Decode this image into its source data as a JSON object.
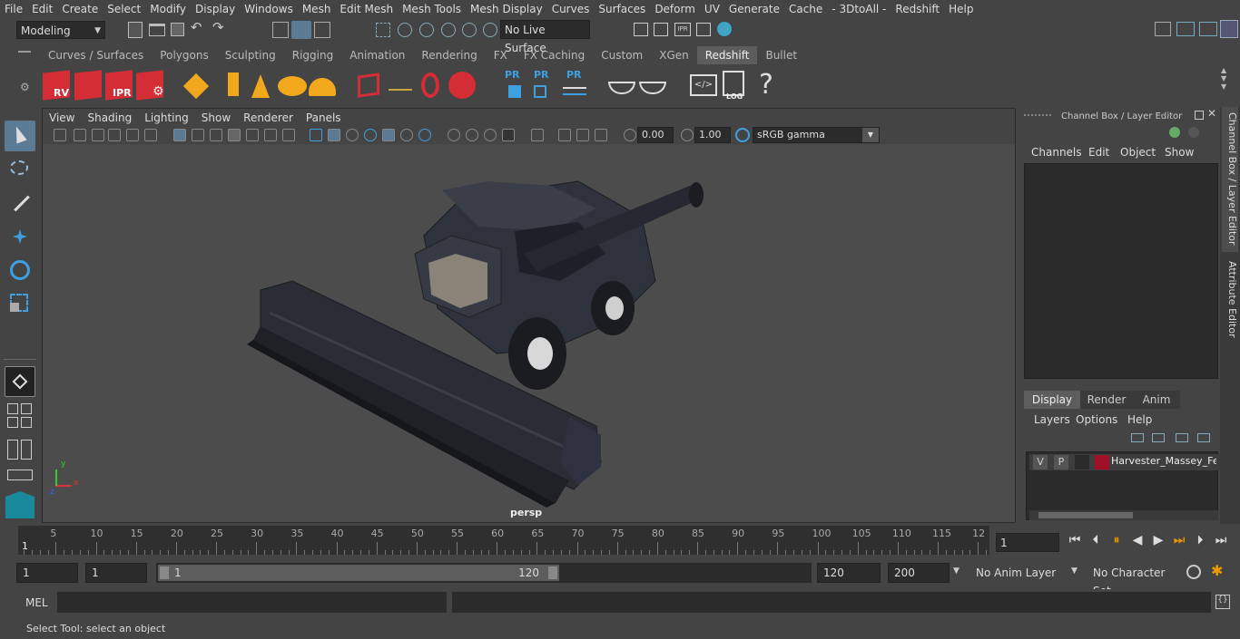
{
  "menubar": [
    "File",
    "Edit",
    "Create",
    "Select",
    "Modify",
    "Display",
    "Windows",
    "Mesh",
    "Edit Mesh",
    "Mesh Tools",
    "Mesh Display",
    "Curves",
    "Surfaces",
    "Deform",
    "UV",
    "Generate",
    "Cache",
    "- 3DtoAll -",
    "Redshift",
    "Help"
  ],
  "status": {
    "mode": "Modeling",
    "live_surface": "No Live Surface"
  },
  "shelf_tabs": [
    "Curves / Surfaces",
    "Polygons",
    "Sculpting",
    "Rigging",
    "Animation",
    "Rendering",
    "FX",
    "FX Caching",
    "Custom",
    "XGen",
    "Redshift",
    "Bullet"
  ],
  "shelf_active": "Redshift",
  "shelf_labels": {
    "rv": "RV",
    "ipr": "IPR",
    "pr": "PR",
    "log": "LOG",
    "help": "?"
  },
  "viewport": {
    "menu": [
      "View",
      "Shading",
      "Lighting",
      "Show",
      "Renderer",
      "Panels"
    ],
    "exposure": "0.00",
    "gamma": "1.00",
    "color_space": "sRGB gamma",
    "camera": "persp",
    "axis": {
      "x": "x",
      "y": "y",
      "z": "z"
    }
  },
  "channel_box": {
    "title": "Channel Box / Layer Editor",
    "menu": [
      "Channels",
      "Edit",
      "Object",
      "Show"
    ]
  },
  "layer_editor": {
    "tabs": [
      "Display",
      "Render",
      "Anim"
    ],
    "active_tab": "Display",
    "menu": [
      "Layers",
      "Options",
      "Help"
    ],
    "layer": {
      "v": "V",
      "p": "P",
      "name": "Harvester_Massey_Ferg",
      "color": "#a0102a"
    }
  },
  "side_tabs": [
    "Channel Box / Layer Editor",
    "Attribute Editor"
  ],
  "timeline": {
    "ticks": [
      "5",
      "10",
      "15",
      "20",
      "25",
      "30",
      "35",
      "40",
      "45",
      "50",
      "55",
      "60",
      "65",
      "70",
      "75",
      "80",
      "85",
      "90",
      "95",
      "100",
      "105",
      "110",
      "115",
      "12"
    ],
    "start_marker": "1",
    "current_frame": "1"
  },
  "range": {
    "start": "1",
    "playback_start": "1",
    "slider_start": "1",
    "slider_end": "120",
    "playback_end": "120",
    "end": "200",
    "anim_layer": "No Anim Layer",
    "character_set": "No Character Set"
  },
  "cmdline": {
    "lang": "MEL"
  },
  "help_line": "Select Tool: select an object"
}
